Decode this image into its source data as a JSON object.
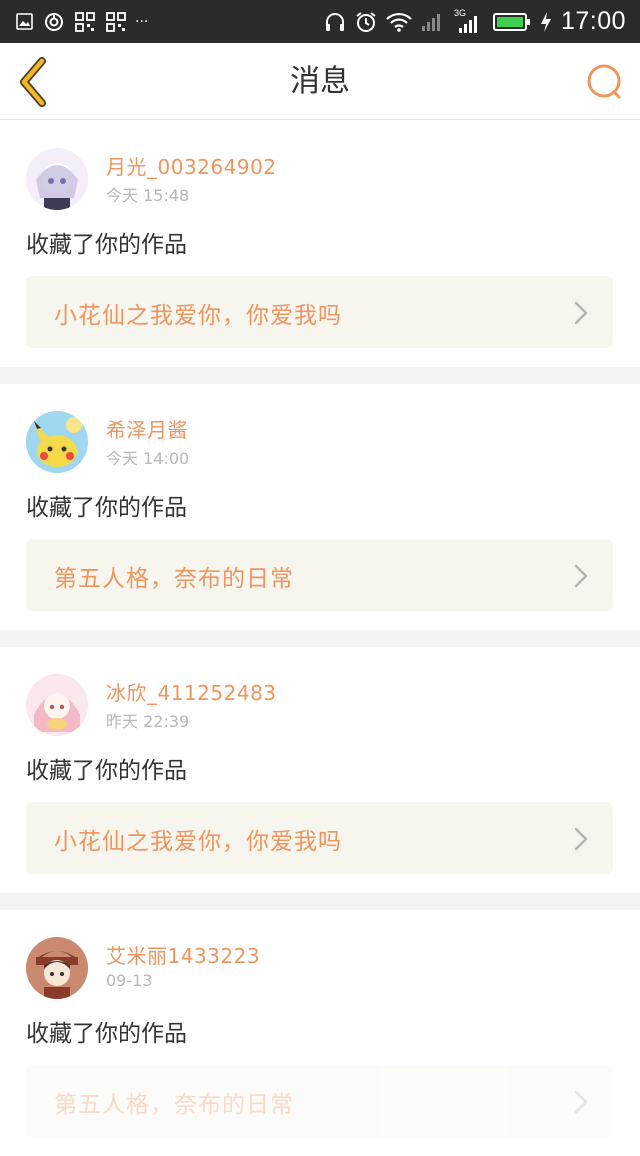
{
  "status_bar": {
    "time": "17:00",
    "network_label": "3G",
    "dots": "···"
  },
  "header": {
    "title": "消息"
  },
  "messages": [
    {
      "username": "月光_003264902",
      "time": "今天  15:48",
      "action": "收藏了你的作品",
      "work_title": "小花仙之我爱你，你爱我吗",
      "avatar_colors": [
        "#f3eef8",
        "#c7c0e0",
        "#ffffff"
      ]
    },
    {
      "username": "希泽月酱",
      "time": "今天  14:00",
      "action": "收藏了你的作品",
      "work_title": "第五人格，奈布的日常",
      "avatar_colors": [
        "#9fd7f0",
        "#f4d94a",
        "#ffffff"
      ]
    },
    {
      "username": "冰欣_411252483",
      "time": "昨天  22:39",
      "action": "收藏了你的作品",
      "work_title": "小花仙之我爱你，你爱我吗",
      "avatar_colors": [
        "#fbe8ec",
        "#f3b9c6",
        "#ffffff"
      ]
    },
    {
      "username": "艾米丽1433223",
      "time": "09-13",
      "action": "收藏了你的作品",
      "work_title": "第五人格，奈布的日常",
      "avatar_colors": [
        "#c98a6f",
        "#4a3a36",
        "#f7e5d5"
      ]
    }
  ],
  "colors": {
    "accent": "#f1955e",
    "back_icon": "#f2b728",
    "status_bar_bg": "#2b2b2b",
    "card_box_bg": "#f6f5ee",
    "separator": "#f3f3f3"
  },
  "icons": {
    "back": "chevron-left-icon",
    "search": "search-icon"
  }
}
